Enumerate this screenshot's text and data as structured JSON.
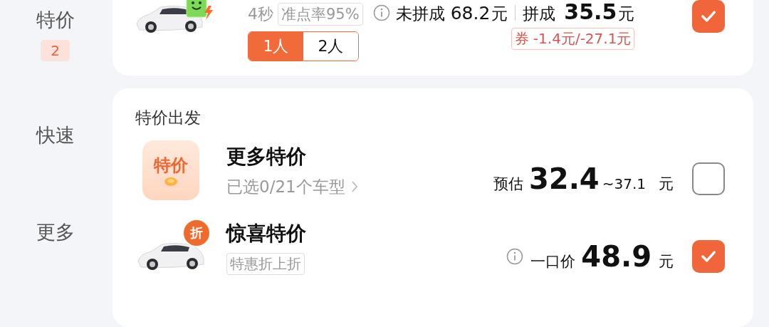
{
  "sidebar": {
    "items": [
      {
        "label": "特价",
        "badge": "2"
      },
      {
        "label": "快速"
      },
      {
        "label": "更多"
      }
    ]
  },
  "top_option": {
    "wait": "4秒",
    "tag": "准点率95%",
    "seats": [
      {
        "label": "1人",
        "selected": true
      },
      {
        "label": "2人",
        "selected": false
      }
    ],
    "unpooled_label": "未拼成",
    "unpooled_price": "68.2",
    "unpooled_unit": "元",
    "pooled_label": "拼成",
    "pooled_price": "35.5",
    "pooled_unit": "元",
    "coupon": "券 -1.4元/-27.1元",
    "checked": true
  },
  "section": {
    "title": "特价出发",
    "items": [
      {
        "kind": "bundle",
        "icon_text": "特价",
        "title": "更多特价",
        "subtitle": "已选0/21个车型",
        "price_label": "预估",
        "price": "32.4",
        "price_max": "~37.1",
        "unit": "元",
        "checked": false
      },
      {
        "kind": "car",
        "badge": "折",
        "title": "惊喜特价",
        "tag": "特惠折上折",
        "price_label": "一口价",
        "price": "48.9",
        "unit": "元",
        "checked": true
      }
    ]
  }
}
